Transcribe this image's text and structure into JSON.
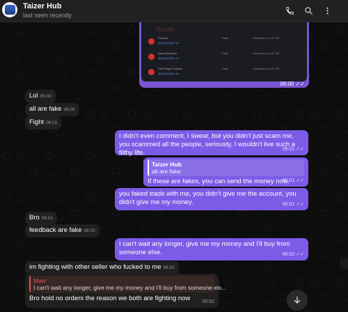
{
  "header": {
    "title": "Taizer Hub",
    "subtitle": "last seen recently",
    "icons": [
      "phone-icon",
      "search-icon",
      "more-icon"
    ]
  },
  "screenshot": {
    "header_text": "Bundle",
    "rows": [
      {
        "name": "Contact",
        "tag": "@@@@@@ ##",
        "type": "Trade",
        "date": "Yesterday at 4:31 PM"
      },
      {
        "name": "Nova Overhaul",
        "tag": "@@@@@@ ##",
        "type": "Trade",
        "date": "Yesterday at 4:31 PM"
      },
      {
        "name": "Dark Rage Fortress",
        "tag": "@@@@@@ ##",
        "type": "Trade",
        "date": "Yesterday at 4:31 PM"
      }
    ],
    "time": "06:00"
  },
  "messages": [
    {
      "text": "Lol",
      "time": "06:00"
    },
    {
      "text": "all are fake",
      "time": "06:00"
    },
    {
      "text": "Fight",
      "time": "06:01"
    },
    {
      "text": "I didn't even comment, I swear, but you didn't just scam me, you scammed all the people, seriously, I wouldn't live such a filthy life.",
      "time": "06:01"
    },
    {
      "quote_name": "Taizer Hub",
      "quote_text": "all are fake",
      "text": "If these are fakes, you can send the money now.",
      "time": "06:01"
    },
    {
      "text": "you faked trade with me, you didn't give me the account, you didn't give me my money.",
      "time": "06:01"
    },
    {
      "text": "Bro",
      "time": "06:01"
    },
    {
      "text": "feedback are fake",
      "time": "06:02"
    },
    {
      "text": "I can't wait any longer, give me my money and I'll buy from someone else.",
      "time": "06:02"
    },
    {
      "text": "im fighting with other seller who fucked to me",
      "time": "06:02"
    },
    {
      "quote_name": "Maw",
      "quote_text": "I can't wait any longer, give me my money and I'll buy from someone els...",
      "text": "Bro hold no orders the reason we both are fighting now",
      "time": "06:02"
    }
  ],
  "colors": {
    "outgoing": "#7c5ce6",
    "incoming": "#202020",
    "background": "#0d0d0d",
    "header": "#212121"
  }
}
